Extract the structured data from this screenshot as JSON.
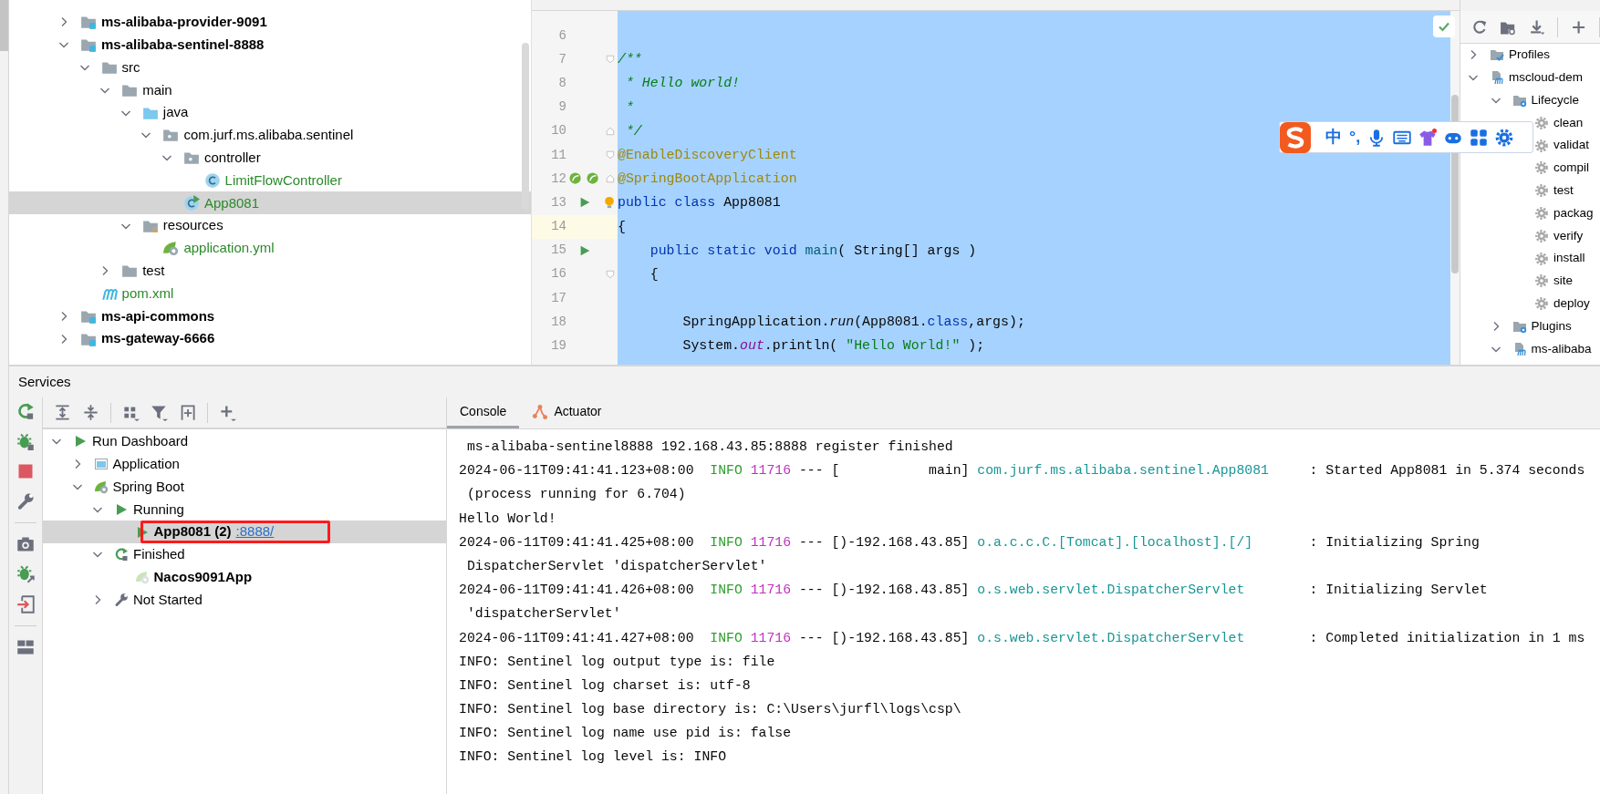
{
  "project": {
    "items": [
      {
        "label": "ms-alibaba-provider-9091",
        "kind": "module",
        "expanded": false,
        "selected": false
      },
      {
        "label": "ms-alibaba-sentinel-8888",
        "kind": "module",
        "expanded": true,
        "selected": false,
        "children": [
          {
            "label": "src",
            "kind": "folder",
            "expanded": true,
            "selected": false,
            "children": [
              {
                "label": "main",
                "kind": "folder",
                "expanded": true,
                "selected": false,
                "children": [
                  {
                    "label": "java",
                    "kind": "source-root",
                    "expanded": true,
                    "selected": false,
                    "children": [
                      {
                        "label": "com.jurf.ms.alibaba.sentinel",
                        "kind": "package",
                        "expanded": true,
                        "selected": false,
                        "children": [
                          {
                            "label": "controller",
                            "kind": "package",
                            "expanded": true,
                            "selected": false,
                            "children": [
                              {
                                "label": "LimitFlowController",
                                "kind": "class",
                                "added": true,
                                "selected": false
                              }
                            ]
                          },
                          {
                            "label": "App8081",
                            "kind": "main-class",
                            "added": true,
                            "selected": true
                          }
                        ]
                      }
                    ]
                  },
                  {
                    "label": "resources",
                    "kind": "resources",
                    "expanded": true,
                    "selected": false,
                    "children": [
                      {
                        "label": "application.yml",
                        "kind": "config",
                        "added": true,
                        "selected": false
                      }
                    ]
                  }
                ]
              },
              {
                "label": "test",
                "kind": "folder",
                "expanded": false,
                "selected": false
              }
            ]
          },
          {
            "label": "pom.xml",
            "kind": "pom",
            "added": true,
            "selected": false
          }
        ]
      },
      {
        "label": "ms-api-commons",
        "kind": "module",
        "expanded": false,
        "selected": false
      },
      {
        "label": "ms-gateway-6666",
        "kind": "module",
        "expanded": false,
        "selected": false
      }
    ]
  },
  "editor": {
    "lines": [
      {
        "number": "6"
      },
      {
        "number": "7",
        "fold_start": true,
        "segments": [
          {
            "kind": "comment",
            "text": "/**"
          }
        ]
      },
      {
        "number": "8",
        "segments": [
          {
            "kind": "comment",
            "text": " * Hello world!"
          }
        ]
      },
      {
        "number": "9",
        "segments": [
          {
            "kind": "comment",
            "text": " *"
          }
        ]
      },
      {
        "number": "10",
        "fold_end": true,
        "segments": [
          {
            "kind": "comment",
            "text": " */"
          }
        ]
      },
      {
        "number": "11",
        "fold_start": true,
        "segments": [
          {
            "kind": "annotation",
            "text": "@EnableDiscoveryClient"
          }
        ]
      },
      {
        "number": "12",
        "fold_end": true,
        "bean_markers": true,
        "segments": [
          {
            "kind": "annotation",
            "text": "@SpringBootApplication"
          }
        ]
      },
      {
        "number": "13",
        "run_button": true,
        "bulb": true,
        "segments": [
          {
            "kind": "keyword",
            "text": "public class"
          },
          {
            "kind": "plain",
            "text": " App8081"
          }
        ]
      },
      {
        "number": "14",
        "current": true,
        "segments": [
          {
            "kind": "plain",
            "text": "{"
          }
        ]
      },
      {
        "number": "15",
        "run_button": true,
        "segments": [
          {
            "kind": "keyword",
            "text": "    public static void "
          },
          {
            "kind": "method",
            "text": "main"
          },
          {
            "kind": "plain",
            "text": "( String[] args )"
          }
        ]
      },
      {
        "number": "16",
        "fold_start": true,
        "segments": [
          {
            "kind": "plain",
            "text": "    {"
          }
        ]
      },
      {
        "number": "17"
      },
      {
        "number": "18",
        "segments": [
          {
            "kind": "plain",
            "text": "        SpringApplication."
          },
          {
            "kind": "static-call",
            "text": "run"
          },
          {
            "kind": "plain",
            "text": "(App8081."
          },
          {
            "kind": "keyword",
            "text": "class"
          },
          {
            "kind": "plain",
            "text": ",args);"
          }
        ]
      },
      {
        "number": "19",
        "segments": [
          {
            "kind": "plain",
            "text": "        System."
          },
          {
            "kind": "field",
            "text": "out"
          },
          {
            "kind": "plain",
            "text": ".println( "
          },
          {
            "kind": "string",
            "text": "\"Hello World!\""
          },
          {
            "kind": "plain",
            "text": " );"
          }
        ]
      }
    ]
  },
  "input_method_bar": {
    "mode": "中",
    "punctuation": "°,"
  },
  "maven": {
    "items": [
      {
        "label": "Profiles",
        "kind": "profiles",
        "expanded": false,
        "selected": false
      },
      {
        "label": "mscloud-dem",
        "kind": "project",
        "expanded": true,
        "selected": false,
        "children": [
          {
            "label": "Lifecycle",
            "kind": "lifecycle",
            "expanded": true,
            "selected": false,
            "children": [
              {
                "label": "clean",
                "kind": "goal",
                "selected": false
              },
              {
                "label": "validat",
                "kind": "goal",
                "selected": false
              },
              {
                "label": "compil",
                "kind": "goal",
                "selected": false
              },
              {
                "label": "test",
                "kind": "goal",
                "selected": false
              },
              {
                "label": "packag",
                "kind": "goal",
                "selected": false
              },
              {
                "label": "verify",
                "kind": "goal",
                "selected": false
              },
              {
                "label": "install",
                "kind": "goal",
                "selected": false
              },
              {
                "label": "site",
                "kind": "goal",
                "selected": false
              },
              {
                "label": "deploy",
                "kind": "goal",
                "selected": false
              }
            ]
          },
          {
            "label": "Plugins",
            "kind": "plugins",
            "expanded": false,
            "selected": false
          },
          {
            "label": "ms-alibaba",
            "kind": "project",
            "expanded": true,
            "selected": false
          }
        ]
      }
    ]
  },
  "services": {
    "title": "Services",
    "items": [
      {
        "label": "Run Dashboard",
        "kind": "dashboard",
        "expanded": true,
        "selected": false,
        "children": [
          {
            "label": "Application",
            "kind": "app-type",
            "expanded": false,
            "selected": false
          },
          {
            "label": "Spring Boot",
            "kind": "spring-type",
            "expanded": true,
            "selected": false,
            "children": [
              {
                "label": "Running",
                "kind": "running",
                "expanded": true,
                "selected": false,
                "children": [
                  {
                    "label": "App8081 (2)",
                    "link": ":8888/",
                    "kind": "service-running",
                    "selected": true,
                    "annotated": true
                  }
                ]
              },
              {
                "label": "Finished",
                "kind": "finished",
                "expanded": true,
                "selected": false,
                "children": [
                  {
                    "label": "Nacos9091App",
                    "kind": "service-stopped",
                    "selected": false,
                    "annotated": false
                  }
                ]
              },
              {
                "label": "Not Started",
                "kind": "not-started",
                "expanded": false,
                "selected": false
              }
            ]
          }
        ]
      }
    ]
  },
  "console": {
    "tabs": [
      {
        "label": "Console",
        "kind": "console",
        "selected": true
      },
      {
        "label": "Actuator",
        "kind": "actuator",
        "selected": false
      }
    ],
    "lines": [
      [
        {
          "kind": "plain",
          "text": " ms-alibaba-sentinel8888 192.168.43.85:8888 register finished"
        }
      ],
      [
        {
          "kind": "plain",
          "text": "2024-06-11T09:41:41.123+08:00  "
        },
        {
          "kind": "level",
          "text": "INFO"
        },
        {
          "kind": "pid",
          "text": " 11716"
        },
        {
          "kind": "plain",
          "text": " --- [           main] "
        },
        {
          "kind": "logger",
          "text": "com.jurf.ms.alibaba.sentinel.App8081"
        },
        {
          "kind": "plain",
          "text": "     : Started App8081 in 5.374 seconds"
        }
      ],
      [
        {
          "kind": "plain",
          "text": " (process running for 6.704)"
        }
      ],
      [
        {
          "kind": "plain",
          "text": "Hello World!"
        }
      ],
      [
        {
          "kind": "plain",
          "text": "2024-06-11T09:41:41.425+08:00  "
        },
        {
          "kind": "level",
          "text": "INFO"
        },
        {
          "kind": "pid",
          "text": " 11716"
        },
        {
          "kind": "plain",
          "text": " --- [)-192.168.43.85] "
        },
        {
          "kind": "logger",
          "text": "o.a.c.c.C.[Tomcat].[localhost].[/]"
        },
        {
          "kind": "plain",
          "text": "       : Initializing Spring"
        }
      ],
      [
        {
          "kind": "plain",
          "text": " DispatcherServlet 'dispatcherServlet'"
        }
      ],
      [
        {
          "kind": "plain",
          "text": "2024-06-11T09:41:41.426+08:00  "
        },
        {
          "kind": "level",
          "text": "INFO"
        },
        {
          "kind": "pid",
          "text": " 11716"
        },
        {
          "kind": "plain",
          "text": " --- [)-192.168.43.85] "
        },
        {
          "kind": "logger",
          "text": "o.s.web.servlet.DispatcherServlet"
        },
        {
          "kind": "plain",
          "text": "        : Initializing Servlet"
        }
      ],
      [
        {
          "kind": "plain",
          "text": " 'dispatcherServlet'"
        }
      ],
      [
        {
          "kind": "plain",
          "text": "2024-06-11T09:41:41.427+08:00  "
        },
        {
          "kind": "level",
          "text": "INFO"
        },
        {
          "kind": "pid",
          "text": " 11716"
        },
        {
          "kind": "plain",
          "text": " --- [)-192.168.43.85] "
        },
        {
          "kind": "logger",
          "text": "o.s.web.servlet.DispatcherServlet"
        },
        {
          "kind": "plain",
          "text": "        : Completed initialization in 1 ms"
        }
      ],
      [
        {
          "kind": "plain",
          "text": "INFO: Sentinel log output type is: file"
        }
      ],
      [
        {
          "kind": "plain",
          "text": "INFO: Sentinel log charset is: utf-8"
        }
      ],
      [
        {
          "kind": "plain",
          "text": "INFO: Sentinel log base directory is: C:\\Users\\jurfl\\logs\\csp\\"
        }
      ],
      [
        {
          "kind": "plain",
          "text": "INFO: Sentinel log name use pid is: false"
        }
      ],
      [
        {
          "kind": "plain",
          "text": "INFO: Sentinel log level is: INFO"
        }
      ]
    ]
  }
}
